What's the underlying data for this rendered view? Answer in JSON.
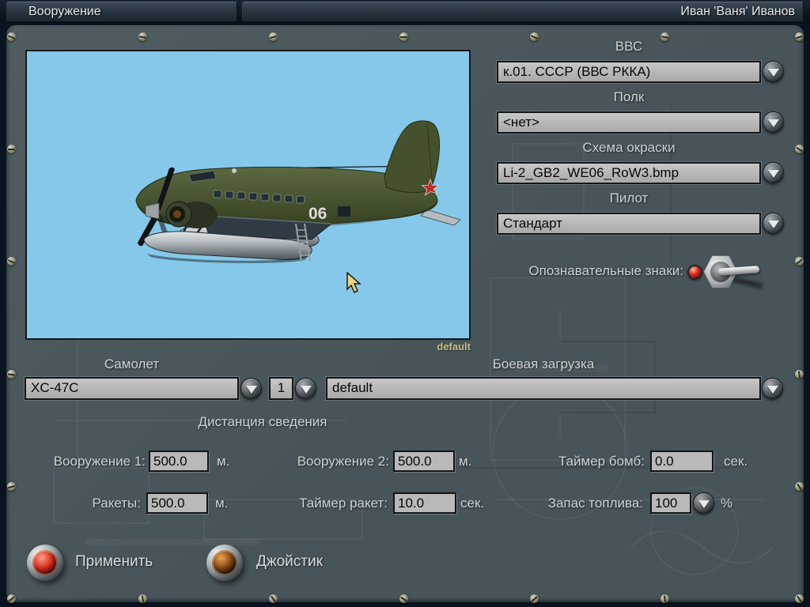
{
  "header": {
    "title": "Вооружение",
    "player_name": "Иван 'Ваня' Иванов"
  },
  "preview": {
    "caption": "default",
    "tail_number": "06",
    "description": "olive-green Li-2 floatplane on silver pontoons, red star on tail"
  },
  "selectors": {
    "air_force": {
      "label": "ВВС",
      "value": "к.01. СССР (ВВС РККА)"
    },
    "regiment": {
      "label": "Полк",
      "value": "<нет>"
    },
    "paint_scheme": {
      "label": "Схема окраски",
      "value": "Li-2_GB2_WE06_RoW3.bmp"
    },
    "pilot": {
      "label": "Пилот",
      "value": "Стандарт"
    },
    "markings_label": "Опознавательные знаки:"
  },
  "aircraft_row": {
    "aircraft_label": "Самолет",
    "aircraft_value": "XC-47C",
    "variant_value": "1",
    "loadout_label": "Боевая загрузка",
    "loadout_value": "default"
  },
  "convergence": {
    "title": "Дистанция сведения",
    "weapon1_label": "Вооружение 1:",
    "weapon1_value": "500.0",
    "weapon1_unit": "м.",
    "weapon2_label": "Вооружение 2:",
    "weapon2_value": "500.0",
    "weapon2_unit": "м.",
    "bomb_timer_label": "Таймер бомб:",
    "bomb_timer_value": "0.0",
    "bomb_timer_unit": "сек.",
    "rockets_label": "Ракеты:",
    "rockets_value": "500.0",
    "rockets_unit": "м.",
    "rocket_timer_label": "Таймер ракет:",
    "rocket_timer_value": "10.0",
    "rocket_timer_unit": "сек.",
    "fuel_label": "Запас топлива:",
    "fuel_value": "100",
    "fuel_unit": "%"
  },
  "buttons": {
    "apply": "Применить",
    "joystick": "Джойстик"
  },
  "colors": {
    "panel": "#4c5a5e",
    "sky": "#86c8e9",
    "control_fill": "#b5b5b5",
    "label_text": "#ccd3d1",
    "caption_text": "#cdbf85",
    "lamp_red": "#d42818",
    "button_red": "#d62c1a",
    "button_amber": "#c07828"
  }
}
